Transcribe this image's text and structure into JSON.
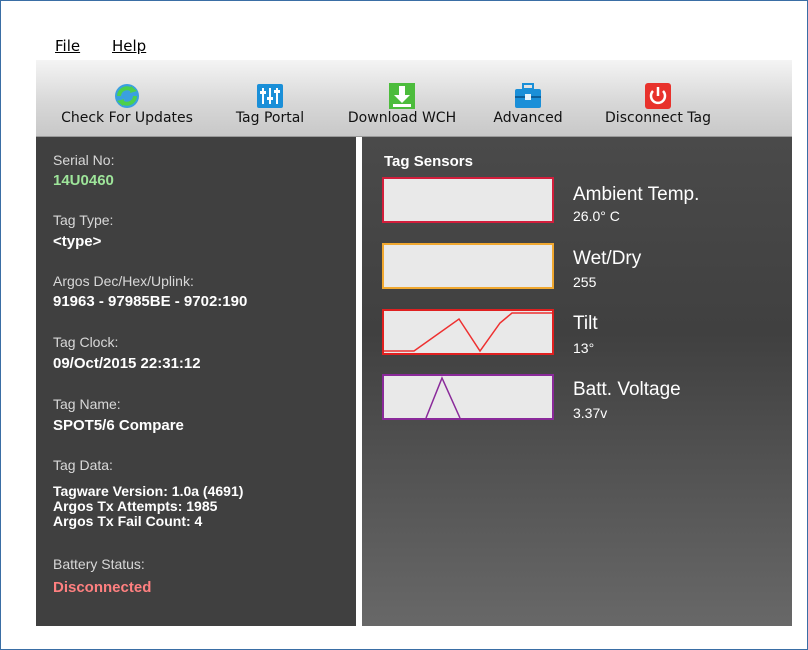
{
  "menu": {
    "file": "File",
    "help": "Help"
  },
  "toolbar": {
    "check_updates": "Check For Updates",
    "tag_portal": "Tag Portal",
    "download_wch": "Download WCH",
    "advanced": "Advanced",
    "disconnect_tag": "Disconnect Tag"
  },
  "icons": {
    "check_updates": "refresh-globe-icon",
    "tag_portal": "sliders-icon",
    "download_wch": "download-icon",
    "advanced": "toolbox-icon",
    "disconnect_tag": "power-icon"
  },
  "info": {
    "serial_label": "Serial No:",
    "serial_value": "14U0460",
    "tag_type_label": "Tag Type:",
    "tag_type_value": "<type>",
    "argos_label": "Argos Dec/Hex/Uplink:",
    "argos_value": "91963 - 97985BE - 9702:190",
    "clock_label": "Tag Clock:",
    "clock_value": "09/Oct/2015 22:31:12",
    "name_label": "Tag Name:",
    "name_value": "SPOT5/6 Compare",
    "data_label": "Tag Data:",
    "data_lines": [
      "Tagware Version: 1.0a (4691)",
      "Argos Tx Attempts: 1985",
      "Argos Tx Fail Count: 4"
    ],
    "battery_label": "Battery Status:",
    "battery_value": "Disconnected"
  },
  "sensors": {
    "title": "Tag Sensors",
    "items": [
      {
        "name": "Ambient Temp.",
        "value": "26.0° C",
        "color": "#d21e3c"
      },
      {
        "name": "Wet/Dry",
        "value": "255",
        "color": "#f0a830"
      },
      {
        "name": "Tilt",
        "value": "13°",
        "color": "#e02020"
      },
      {
        "name": "Batt. Voltage",
        "value": "3.37v",
        "color": "#8a2a9a"
      }
    ]
  },
  "colors": {
    "accent_green": "#9ee59a",
    "disconnected_red": "#ff8080"
  }
}
